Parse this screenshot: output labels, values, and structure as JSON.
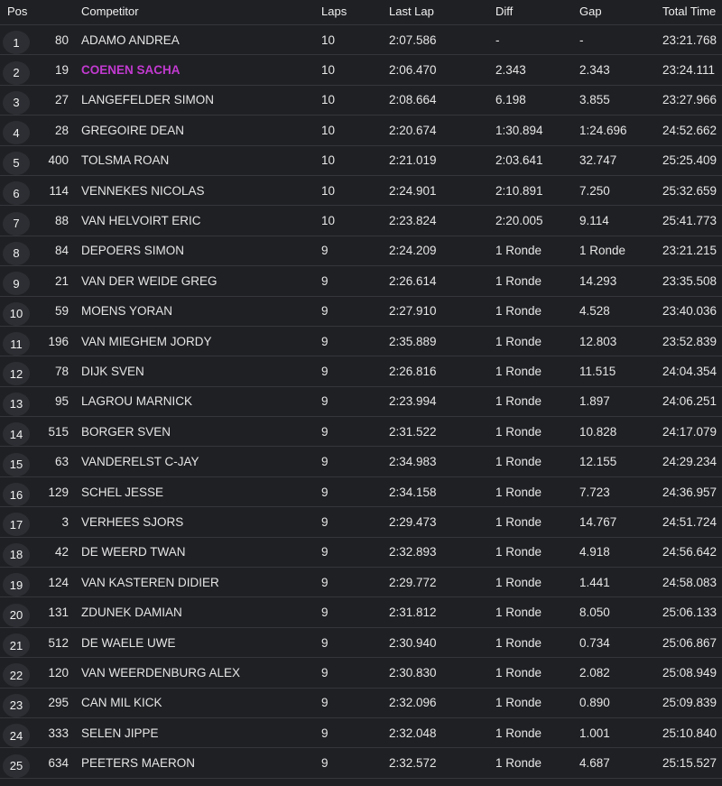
{
  "headers": {
    "pos": "Pos",
    "competitor": "Competitor",
    "laps": "Laps",
    "last_lap": "Last Lap",
    "diff": "Diff",
    "gap": "Gap",
    "total_time": "Total Time"
  },
  "colors": {
    "highlight": "#c23ad0",
    "background": "#1f2024",
    "row_border": "#34363b"
  },
  "rows": [
    {
      "pos": "1",
      "num": "80",
      "name": "ADAMO ANDREA",
      "laps": "10",
      "last": "2:07.586",
      "diff": "-",
      "gap": "-",
      "total": "23:21.768",
      "highlight": false
    },
    {
      "pos": "2",
      "num": "19",
      "name": "COENEN SACHA",
      "laps": "10",
      "last": "2:06.470",
      "diff": "2.343",
      "gap": "2.343",
      "total": "23:24.111",
      "highlight": true
    },
    {
      "pos": "3",
      "num": "27",
      "name": "LANGEFELDER SIMON",
      "laps": "10",
      "last": "2:08.664",
      "diff": "6.198",
      "gap": "3.855",
      "total": "23:27.966",
      "highlight": false
    },
    {
      "pos": "4",
      "num": "28",
      "name": "GREGOIRE DEAN",
      "laps": "10",
      "last": "2:20.674",
      "diff": "1:30.894",
      "gap": "1:24.696",
      "total": "24:52.662",
      "highlight": false
    },
    {
      "pos": "5",
      "num": "400",
      "name": "TOLSMA ROAN",
      "laps": "10",
      "last": "2:21.019",
      "diff": "2:03.641",
      "gap": "32.747",
      "total": "25:25.409",
      "highlight": false
    },
    {
      "pos": "6",
      "num": "114",
      "name": "VENNEKES NICOLAS",
      "laps": "10",
      "last": "2:24.901",
      "diff": "2:10.891",
      "gap": "7.250",
      "total": "25:32.659",
      "highlight": false
    },
    {
      "pos": "7",
      "num": "88",
      "name": "VAN HELVOIRT ERIC",
      "laps": "10",
      "last": "2:23.824",
      "diff": "2:20.005",
      "gap": "9.114",
      "total": "25:41.773",
      "highlight": false
    },
    {
      "pos": "8",
      "num": "84",
      "name": "DEPOERS SIMON",
      "laps": "9",
      "last": "2:24.209",
      "diff": "1 Ronde",
      "gap": "1 Ronde",
      "total": "23:21.215",
      "highlight": false
    },
    {
      "pos": "9",
      "num": "21",
      "name": "VAN DER WEIDE GREG",
      "laps": "9",
      "last": "2:26.614",
      "diff": "1 Ronde",
      "gap": "14.293",
      "total": "23:35.508",
      "highlight": false
    },
    {
      "pos": "10",
      "num": "59",
      "name": "MOENS YORAN",
      "laps": "9",
      "last": "2:27.910",
      "diff": "1 Ronde",
      "gap": "4.528",
      "total": "23:40.036",
      "highlight": false
    },
    {
      "pos": "11",
      "num": "196",
      "name": "VAN MIEGHEM JORDY",
      "laps": "9",
      "last": "2:35.889",
      "diff": "1 Ronde",
      "gap": "12.803",
      "total": "23:52.839",
      "highlight": false
    },
    {
      "pos": "12",
      "num": "78",
      "name": "DIJK SVEN",
      "laps": "9",
      "last": "2:26.816",
      "diff": "1 Ronde",
      "gap": "11.515",
      "total": "24:04.354",
      "highlight": false
    },
    {
      "pos": "13",
      "num": "95",
      "name": "LAGROU MARNICK",
      "laps": "9",
      "last": "2:23.994",
      "diff": "1 Ronde",
      "gap": "1.897",
      "total": "24:06.251",
      "highlight": false
    },
    {
      "pos": "14",
      "num": "515",
      "name": "BORGER SVEN",
      "laps": "9",
      "last": "2:31.522",
      "diff": "1 Ronde",
      "gap": "10.828",
      "total": "24:17.079",
      "highlight": false
    },
    {
      "pos": "15",
      "num": "63",
      "name": "VANDERELST C-JAY",
      "laps": "9",
      "last": "2:34.983",
      "diff": "1 Ronde",
      "gap": "12.155",
      "total": "24:29.234",
      "highlight": false
    },
    {
      "pos": "16",
      "num": "129",
      "name": "SCHEL JESSE",
      "laps": "9",
      "last": "2:34.158",
      "diff": "1 Ronde",
      "gap": "7.723",
      "total": "24:36.957",
      "highlight": false
    },
    {
      "pos": "17",
      "num": "3",
      "name": "VERHEES SJORS",
      "laps": "9",
      "last": "2:29.473",
      "diff": "1 Ronde",
      "gap": "14.767",
      "total": "24:51.724",
      "highlight": false
    },
    {
      "pos": "18",
      "num": "42",
      "name": "DE WEERD TWAN",
      "laps": "9",
      "last": "2:32.893",
      "diff": "1 Ronde",
      "gap": "4.918",
      "total": "24:56.642",
      "highlight": false
    },
    {
      "pos": "19",
      "num": "124",
      "name": "VAN KASTEREN DIDIER",
      "laps": "9",
      "last": "2:29.772",
      "diff": "1 Ronde",
      "gap": "1.441",
      "total": "24:58.083",
      "highlight": false
    },
    {
      "pos": "20",
      "num": "131",
      "name": "ZDUNEK DAMIAN",
      "laps": "9",
      "last": "2:31.812",
      "diff": "1 Ronde",
      "gap": "8.050",
      "total": "25:06.133",
      "highlight": false
    },
    {
      "pos": "21",
      "num": "512",
      "name": "DE WAELE UWE",
      "laps": "9",
      "last": "2:30.940",
      "diff": "1 Ronde",
      "gap": "0.734",
      "total": "25:06.867",
      "highlight": false
    },
    {
      "pos": "22",
      "num": "120",
      "name": "VAN WEERDENBURG ALEX",
      "laps": "9",
      "last": "2:30.830",
      "diff": "1 Ronde",
      "gap": "2.082",
      "total": "25:08.949",
      "highlight": false
    },
    {
      "pos": "23",
      "num": "295",
      "name": "CAN MIL KICK",
      "laps": "9",
      "last": "2:32.096",
      "diff": "1 Ronde",
      "gap": "0.890",
      "total": "25:09.839",
      "highlight": false
    },
    {
      "pos": "24",
      "num": "333",
      "name": "SELEN JIPPE",
      "laps": "9",
      "last": "2:32.048",
      "diff": "1 Ronde",
      "gap": "1.001",
      "total": "25:10.840",
      "highlight": false
    },
    {
      "pos": "25",
      "num": "634",
      "name": "PEETERS MAERON",
      "laps": "9",
      "last": "2:32.572",
      "diff": "1 Ronde",
      "gap": "4.687",
      "total": "25:15.527",
      "highlight": false
    }
  ]
}
